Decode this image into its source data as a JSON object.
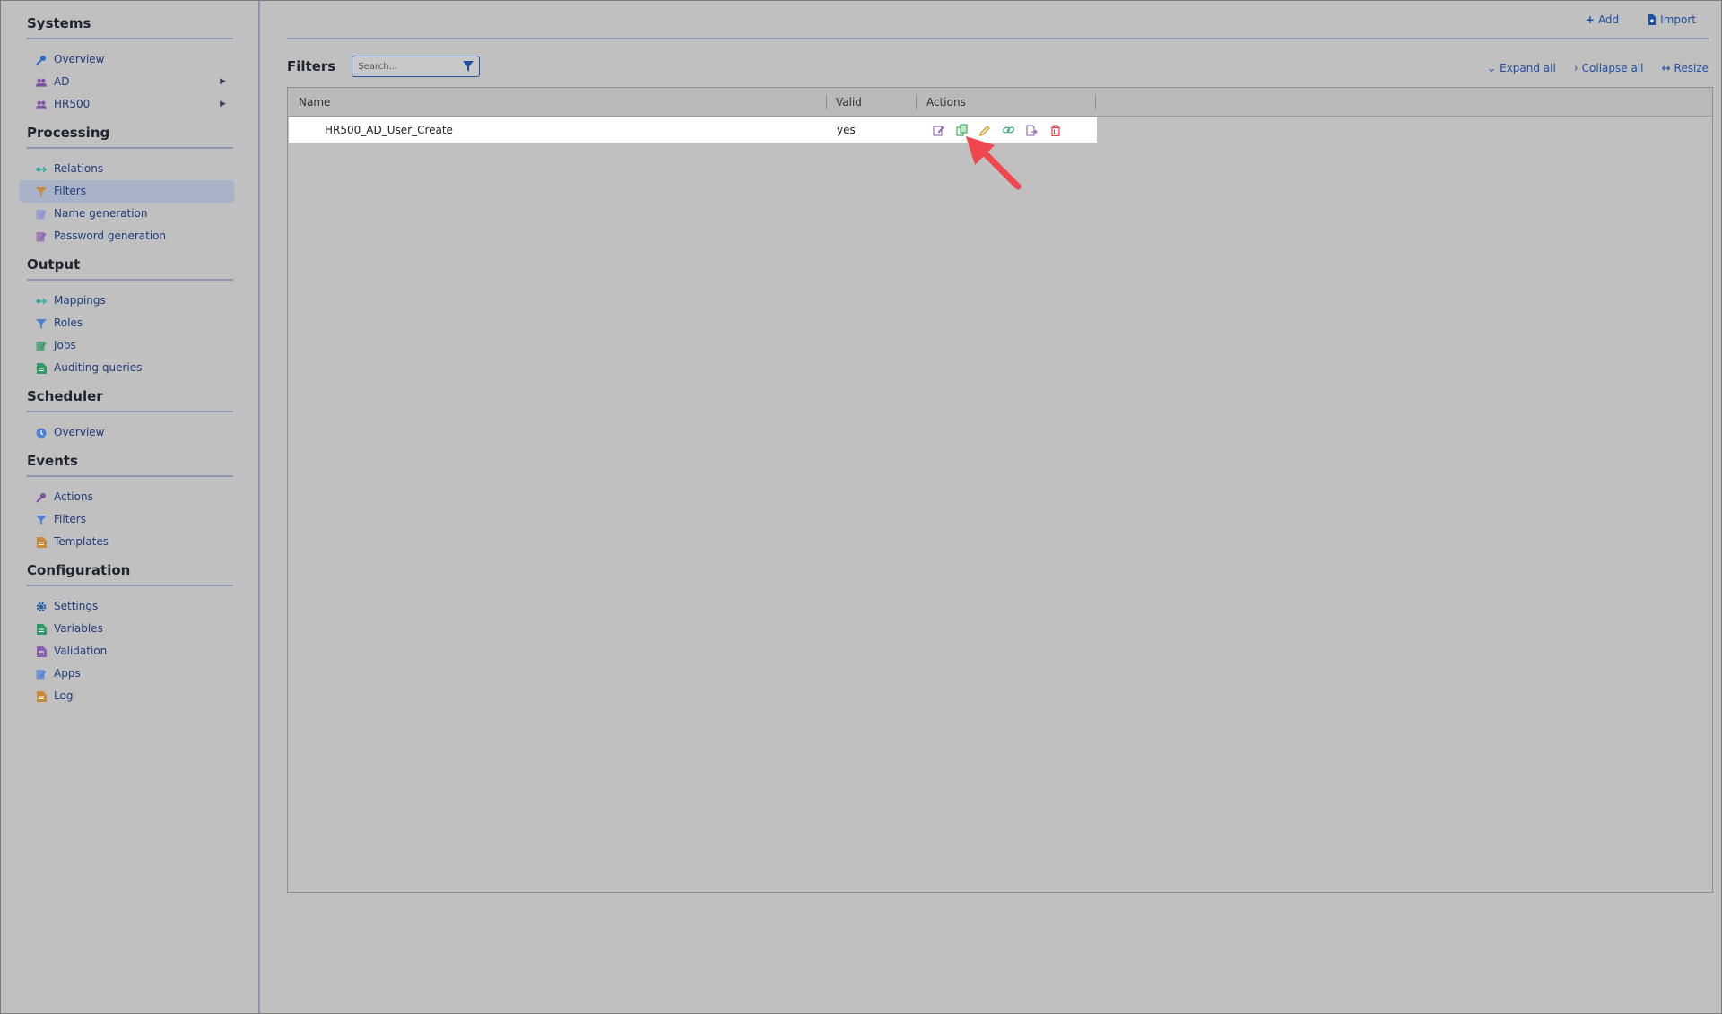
{
  "sidebar": {
    "sections": [
      {
        "title": "Systems",
        "items": [
          {
            "label": "Overview",
            "icon": "wrench-icon",
            "color": "#2b6fc2"
          },
          {
            "label": "AD",
            "icon": "users-icon",
            "color": "#7d4fa3",
            "expandable": true
          },
          {
            "label": "HR500",
            "icon": "users-icon",
            "color": "#7d4fa3",
            "expandable": true
          }
        ]
      },
      {
        "title": "Processing",
        "items": [
          {
            "label": "Relations",
            "icon": "relation-icon",
            "color": "#2aa3a3"
          },
          {
            "label": "Filters",
            "icon": "funnel-icon",
            "color": "#c58a3a",
            "active": true
          },
          {
            "label": "Name generation",
            "icon": "edit-doc-icon",
            "color": "#8a8fd6"
          },
          {
            "label": "Password generation",
            "icon": "edit-doc-icon",
            "color": "#8a5fb3"
          }
        ]
      },
      {
        "title": "Output",
        "items": [
          {
            "label": "Mappings",
            "icon": "relation-icon",
            "color": "#2aa3a3"
          },
          {
            "label": "Roles",
            "icon": "funnel-icon",
            "color": "#4f7fd6"
          },
          {
            "label": "Jobs",
            "icon": "edit-doc-icon",
            "color": "#2f9a66"
          },
          {
            "label": "Auditing queries",
            "icon": "document-icon",
            "color": "#2f9a66"
          }
        ]
      },
      {
        "title": "Scheduler",
        "items": [
          {
            "label": "Overview",
            "icon": "clock-icon",
            "color": "#4f7fd6"
          }
        ]
      },
      {
        "title": "Events",
        "items": [
          {
            "label": "Actions",
            "icon": "wrench-icon",
            "color": "#7d4fa3"
          },
          {
            "label": "Filters",
            "icon": "funnel-icon",
            "color": "#4f7fd6"
          },
          {
            "label": "Templates",
            "icon": "document-icon",
            "color": "#c58a3a"
          }
        ]
      },
      {
        "title": "Configuration",
        "items": [
          {
            "label": "Settings",
            "icon": "gear-icon",
            "color": "#2b5ca8"
          },
          {
            "label": "Variables",
            "icon": "document-icon",
            "color": "#2f9a66"
          },
          {
            "label": "Validation",
            "icon": "document-icon",
            "color": "#8a5fb3"
          },
          {
            "label": "Apps",
            "icon": "edit-doc-icon",
            "color": "#4f7fd6"
          },
          {
            "label": "Log",
            "icon": "document-icon",
            "color": "#c58a3a"
          }
        ]
      }
    ]
  },
  "top_actions": {
    "add_label": "Add",
    "import_label": "Import"
  },
  "filters": {
    "title": "Filters",
    "search_placeholder": "Search...",
    "expand_all": "Expand all",
    "collapse_all": "Collapse all",
    "resize": "Resize"
  },
  "table": {
    "columns": [
      "Name",
      "Valid",
      "Actions"
    ],
    "rows": [
      {
        "name": "HR500_AD_User_Create",
        "valid": "yes",
        "actions": [
          "edit-icon",
          "copy-icon",
          "pencil-icon",
          "link-icon",
          "export-icon",
          "trash-icon"
        ]
      }
    ]
  },
  "colors": {
    "accent": "#1f4fa0",
    "annotation_arrow": "#f0474f",
    "delete": "#e0454f"
  }
}
